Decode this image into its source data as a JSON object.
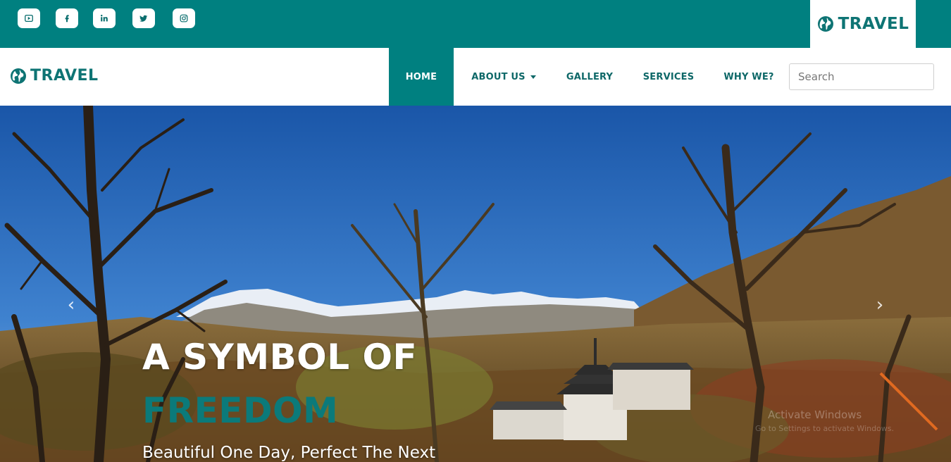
{
  "topbar": {
    "background": "#008080",
    "social_icons": [
      "youtube-icon",
      "facebook-icon",
      "linkedin-icon",
      "twitter-icon",
      "instagram-icon"
    ],
    "brand": "TRAVEL"
  },
  "navbar": {
    "brand": "TRAVEL",
    "items": [
      {
        "label": "HOME",
        "active": true
      },
      {
        "label": "ABOUT US",
        "dropdown": true
      },
      {
        "label": "GALLERY"
      },
      {
        "label": "SERVICES"
      },
      {
        "label": "WHY WE?"
      }
    ],
    "search_placeholder": "Search"
  },
  "hero": {
    "title": "A SYMBOL OF",
    "accent": "FREEDOM",
    "subtitle": "Beautiful One Day, Perfect The Next",
    "accent_color": "#0b7a7a",
    "watermark_line1": "Activate Windows",
    "watermark_line2": "Go to Settings to activate Windows."
  }
}
